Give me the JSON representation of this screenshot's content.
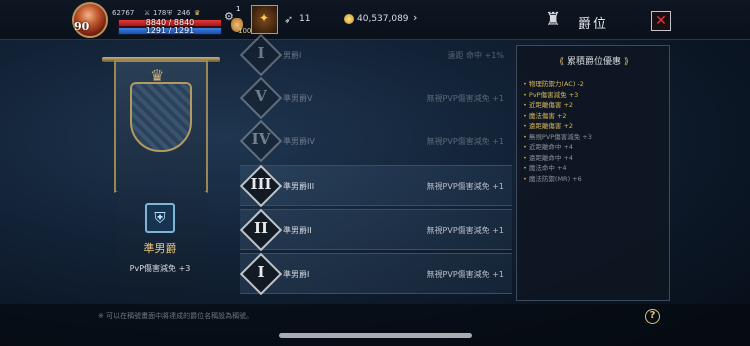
{
  "topbar": {
    "level": "90",
    "stat_a": "62767",
    "stat_b": "178",
    "stat_c": "246",
    "hp": "8840 / 8840",
    "mp": "1291 / 1291",
    "potion_count": "1",
    "potion_amount": "100",
    "feather_value": "11",
    "gold_value": "40,537,089",
    "icons": [
      "avatar",
      "gear-icon",
      "potion-icon",
      "skill-icon",
      "feather-icon",
      "coin-icon",
      "chevron-right-icon"
    ]
  },
  "header": {
    "title": "爵位",
    "close_label": "✕"
  },
  "left_panel": {
    "rank_name": "準男爵",
    "rank_bonus": "PvP傷害減免 +3"
  },
  "ranks": [
    {
      "numeral": "I",
      "label": "男爵I",
      "effect": "遠距 命中 +1%",
      "state": "dim"
    },
    {
      "numeral": "V",
      "label": "準男爵V",
      "effect": "無視PVP傷害減免 +1",
      "state": "dim"
    },
    {
      "numeral": "IV",
      "label": "準男爵IV",
      "effect": "無視PVP傷害減免 +1",
      "state": "dim"
    },
    {
      "numeral": "III",
      "label": "準男爵III",
      "effect": "無視PVP傷害減免 +1",
      "state": "active"
    },
    {
      "numeral": "II",
      "label": "準男爵II",
      "effect": "無視PVP傷害減免 +1",
      "state": "active"
    },
    {
      "numeral": "I",
      "label": "準男爵I",
      "effect": "無視PVP傷害減免 +1",
      "state": "active"
    }
  ],
  "benefits": {
    "title": "累積爵位優惠",
    "items": [
      {
        "text": "物理防禦力(AC) -2",
        "state": "gold"
      },
      {
        "text": "PvP傷害減免 +3",
        "state": "gold"
      },
      {
        "text": "近距離傷害 +2",
        "state": "gold"
      },
      {
        "text": "魔法傷害 +2",
        "state": "gold"
      },
      {
        "text": "遠距離傷害 +2",
        "state": "gold"
      },
      {
        "text": "無視PVP傷害減免 +3",
        "state": "dim"
      },
      {
        "text": "近距離命中 +4",
        "state": "dim"
      },
      {
        "text": "遠距離命中 +4",
        "state": "dim"
      },
      {
        "text": "魔法命中 +4",
        "state": "dim"
      },
      {
        "text": "魔法防禦(MR) +6",
        "state": "dim"
      }
    ]
  },
  "footer": {
    "note": "※ 可以在稱號畫面中將達成的爵位名稱設為稱號。",
    "help_label": "?"
  }
}
